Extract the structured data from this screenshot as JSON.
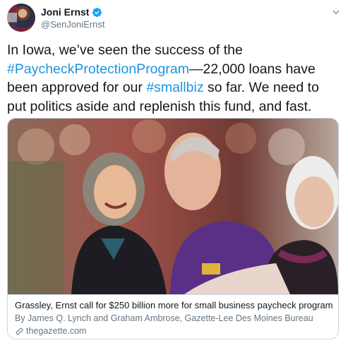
{
  "author": {
    "display_name": "Joni Ernst",
    "handle": "@SenJoniErnst",
    "avatar_icon": "profile-photo",
    "verified_icon": "verified-badge-icon"
  },
  "tweet": {
    "text_part1": "In Iowa, we’ve seen the success of the ",
    "hashtag1": "#PaycheckProtectionProgram",
    "text_part2": "—22,000 loans have been approved for our ",
    "hashtag2": "#smallbiz",
    "text_part3": " so far. We need to put politics aside and replenish this fund, and fast."
  },
  "card": {
    "title": "Grassley, Ernst call for $250 billion more for small business paycheck program",
    "description": "By James Q. Lynch and Graham Ambrose, Gazette-Lee Des Moines Bureau",
    "domain": "thegazette.com",
    "domain_icon": "link-icon"
  },
  "colors": {
    "hashtag": "#1b95e0",
    "text": "#14171a",
    "muted": "#657786",
    "border": "#ccd6dd"
  }
}
